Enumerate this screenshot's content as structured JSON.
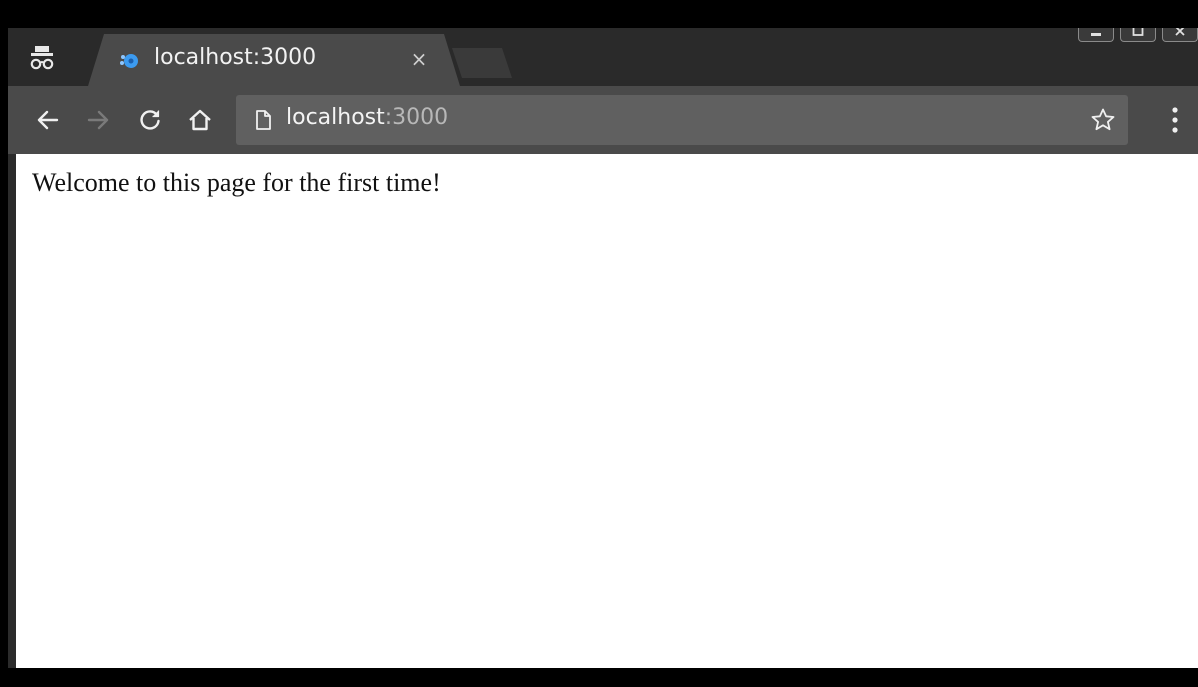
{
  "tab": {
    "title": "localhost:3000",
    "close_label": "×"
  },
  "omnibox": {
    "host": "localhost",
    "port": ":3000"
  },
  "page": {
    "text": "Welcome to this page for the first time!"
  },
  "icons": {
    "incognito": "incognito-icon",
    "favicon": "favicon-icon",
    "back": "back-arrow-icon",
    "forward": "forward-arrow-icon",
    "reload": "reload-icon",
    "home": "home-icon",
    "page": "page-icon",
    "star": "star-icon",
    "menu": "menu-dots-icon"
  },
  "colors": {
    "tabstrip": "#2a2a2a",
    "toolbar": "#4a4a4a",
    "omnibox": "#606060",
    "favicon_accent": "#3c9bf0"
  }
}
